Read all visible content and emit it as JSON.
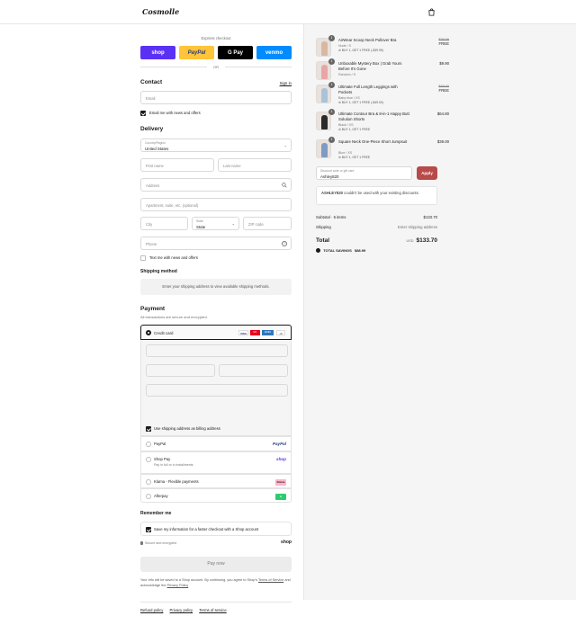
{
  "header": {
    "logo": "Cosmolle",
    "bag_icon": "shopping-bag-icon"
  },
  "express": {
    "label": "Express checkout",
    "buttons": [
      {
        "label": "shop",
        "bg": "#5a31f4",
        "fg": "#ffffff"
      },
      {
        "label": "PayPal",
        "bg": "#ffc439",
        "fg": "#253b80"
      },
      {
        "label": "G Pay",
        "bg": "#000000",
        "fg": "#ffffff"
      },
      {
        "label": "venmo",
        "bg": "#008cff",
        "fg": "#ffffff"
      }
    ],
    "or": "OR"
  },
  "contact": {
    "title": "Contact",
    "sign_in": "Sign in",
    "email_placeholder": "Email",
    "news_label": "Email me with news and offers"
  },
  "delivery": {
    "title": "Delivery",
    "country_label": "Country/Region",
    "country_value": "United States",
    "first_name": "First name",
    "last_name": "Last name",
    "address": "Address",
    "apartment": "Apartment, suite, etc. (optional)",
    "city": "City",
    "state_label": "State",
    "state_value": "State",
    "zip": "ZIP code",
    "phone": "Phone",
    "text_label": "Text me with news and offers"
  },
  "shipping": {
    "title": "Shipping method",
    "info": "Enter your shipping address to view available shipping methods."
  },
  "payment": {
    "title": "Payment",
    "subtitle": "All transactions are secure and encrypted.",
    "credit_card": "Credit card",
    "card_badges": [
      "VISA",
      "MC",
      "AMEX",
      "+5"
    ],
    "billing_label": "Use shipping address as billing address",
    "methods": [
      {
        "label": "PayPal",
        "sub": "",
        "badge": "PayPal",
        "badge_color": "#253b80"
      },
      {
        "label": "Shop Pay",
        "sub": "Pay in full or in installments",
        "badge": "shop",
        "badge_color": "#5a31f4"
      },
      {
        "label": "Klarna - Flexible payments",
        "sub": "",
        "badge": "Klarna",
        "badge_color": "#ffb3c7"
      },
      {
        "label": "Afterpay",
        "sub": "",
        "badge": "A",
        "badge_color": "#2ecc71"
      }
    ]
  },
  "remember": {
    "title": "Remember me",
    "save_label": "Save my information for a faster checkout with a Shop account",
    "secure_note": "Secure and encrypted",
    "shop_brand": "shop"
  },
  "pay_now": "Pay now",
  "legal": {
    "text": "Your info will be saved to a Shop account. By continuing, you agree to Shop's",
    "terms": "Terms of Service",
    "and": "and acknowledge the",
    "privacy": "Privacy Policy"
  },
  "footer": [
    "Refund policy",
    "Privacy policy",
    "Terms of service"
  ],
  "cart": {
    "items": [
      {
        "name": "AirWear Scoop Neck Pullover Bra",
        "variant": "Nude / S",
        "deal": "BUY 1, GET 1 FREE (-$39.99)",
        "original": "$39.99",
        "price": "FREE",
        "qty": "1",
        "color": "#d9b8a3"
      },
      {
        "name": "Unboxable Mystery Box | Grab Yours Before It's Gone",
        "variant": "Random / S",
        "deal": "",
        "original": "",
        "price": "$9.90",
        "qty": "1",
        "color": "#e9a6a6"
      },
      {
        "name": "Ultimate Full Length Leggings with Pockets",
        "variant": "Baby blue / XS",
        "deal": "BUY 1, GET 1 FREE (-$49.00)",
        "original": "$49.00",
        "price": "FREE",
        "qty": "1",
        "color": "#a9c3dc"
      },
      {
        "name": "Ultimate Contour Bra & 8-in-1 Happy Butt Solution Shorts",
        "variant": "Black / XS",
        "deal": "BUY 1, GET 1 FREE",
        "original": "",
        "price": "$64.80",
        "qty": "1",
        "color": "#2a2a2a"
      },
      {
        "name": "Square Neck One-Piece Short Jumpsuit",
        "variant": "Blue / XS",
        "deal": "BUY 1, GET 1 FREE",
        "original": "",
        "price": "$39.00",
        "qty": "1",
        "color": "#7d9bc4"
      }
    ],
    "discount_label": "Discount code or gift card",
    "discount_value": "Ashley820",
    "apply": "Apply",
    "error_code": "ASHLEY820",
    "error_text": "couldn't be used with your existing discounts.",
    "subtotal_label": "Subtotal · 5 items",
    "subtotal_value": "$133.70",
    "shipping_label": "Shipping",
    "shipping_value": "Enter shipping address",
    "total_label": "Total",
    "currency": "USD",
    "total_value": "$133.70",
    "savings_label": "TOTAL SAVINGS",
    "savings_value": "$88.99"
  }
}
